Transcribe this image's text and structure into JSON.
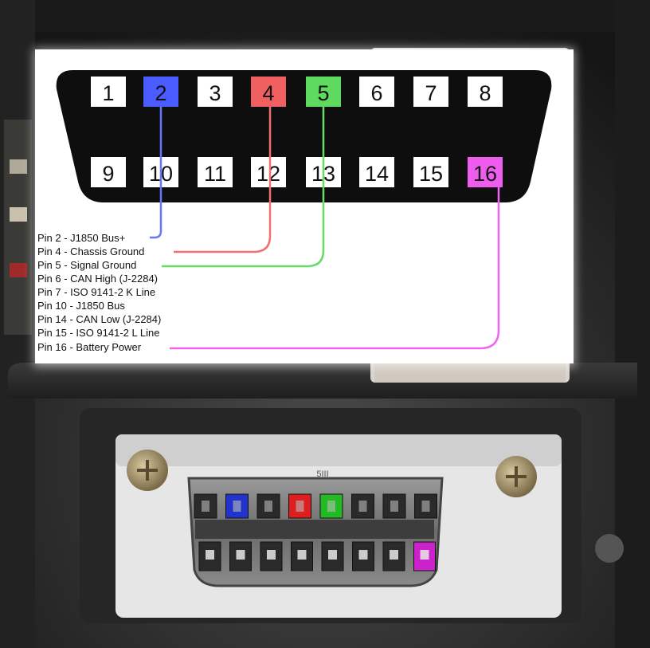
{
  "diagram": {
    "top_pins": [
      {
        "number": "1",
        "highlight": null
      },
      {
        "number": "2",
        "highlight": "#4a5cff"
      },
      {
        "number": "3",
        "highlight": null
      },
      {
        "number": "4",
        "highlight": "#f06060"
      },
      {
        "number": "5",
        "highlight": "#5edb5e"
      },
      {
        "number": "6",
        "highlight": null
      },
      {
        "number": "7",
        "highlight": null
      },
      {
        "number": "8",
        "highlight": null
      }
    ],
    "bottom_pins": [
      {
        "number": "9",
        "highlight": null
      },
      {
        "number": "10",
        "highlight": null
      },
      {
        "number": "11",
        "highlight": null
      },
      {
        "number": "12",
        "highlight": null
      },
      {
        "number": "13",
        "highlight": null
      },
      {
        "number": "14",
        "highlight": null
      },
      {
        "number": "15",
        "highlight": null
      },
      {
        "number": "16",
        "highlight": "#ee5cee"
      }
    ],
    "legend": [
      "Pin 2 - J1850 Bus+",
      "Pin 4 - Chassis Ground",
      "Pin 5 - Signal Ground",
      "Pin 6 - CAN High (J-2284)",
      "Pin 7 - ISO 9141-2 K Line",
      "Pin 10 - J1850 Bus",
      "Pin 14 - CAN Low (J-2284)",
      "Pin 15 - ISO 9141-2 L Line",
      "Pin 16 - Battery Power"
    ],
    "leader_colors": {
      "pin2": "#6677ff",
      "pin4": "#f07070",
      "pin5": "#66dd66",
      "pin16": "#ee66ee"
    }
  },
  "photo": {
    "label": "5III",
    "connector_pin_colors": {
      "pin2": "#2233cc",
      "pin4": "#dd1f1f",
      "pin5": "#22bb22",
      "pin16": "#cc22cc"
    }
  }
}
